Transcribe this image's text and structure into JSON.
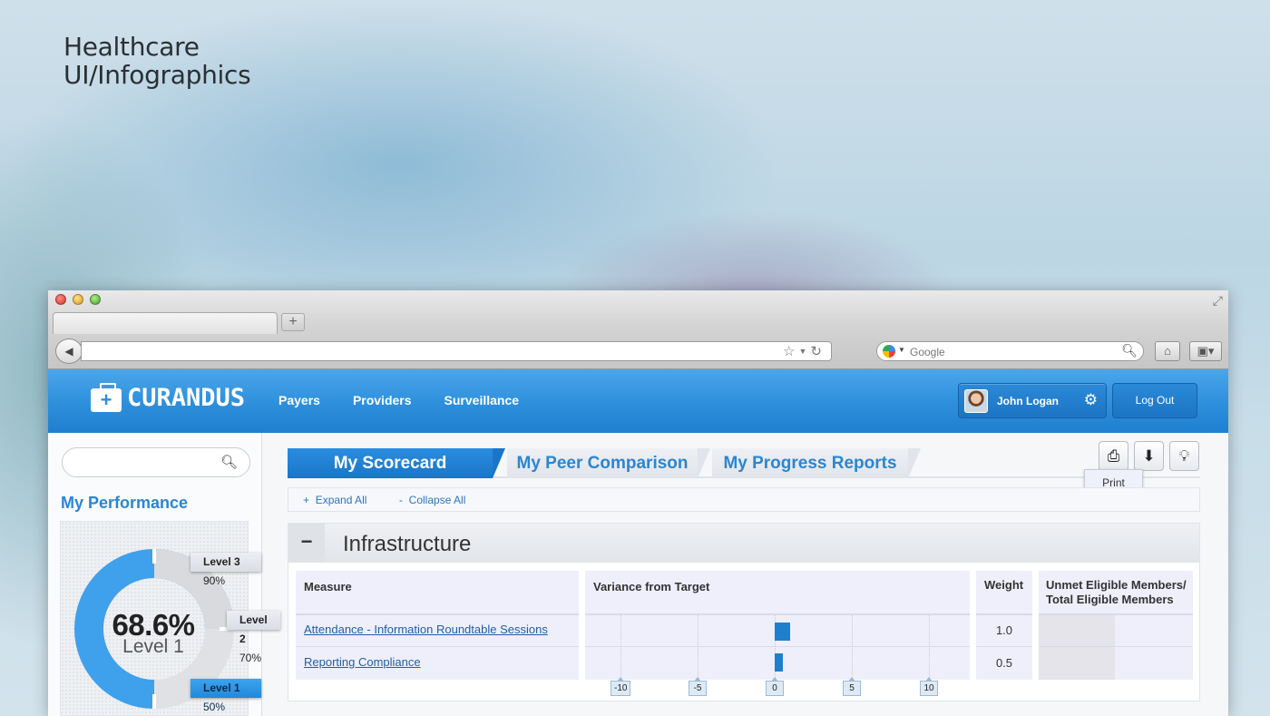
{
  "headline": {
    "line1": "Healthcare",
    "line2": "UI/Infographics"
  },
  "browser": {
    "search_placeholder": "Google",
    "new_tab_symbol": "+"
  },
  "app": {
    "logo_text": "CURANDUS",
    "nav": [
      "Payers",
      "Providers",
      "Surveillance"
    ],
    "user_name": "John Logan",
    "logout_label": "Log Out"
  },
  "sidebar": {
    "performance_title": "My Performance",
    "score_value": "68.6%",
    "score_level": "Level 1",
    "levels": [
      {
        "name": "Level 3",
        "pct": "90%"
      },
      {
        "name": "Level 2",
        "pct": "70%"
      },
      {
        "name": "Level 1",
        "pct": "50%"
      }
    ]
  },
  "tabs": [
    "My Scorecard",
    "My Peer Comparison",
    "My Progress Reports"
  ],
  "tooltip": "Print",
  "actions": {
    "expand_all": "Expand All",
    "collapse_all": "Collapse All"
  },
  "section": {
    "collapse_symbol": "−",
    "title": "Infrastructure",
    "headers": {
      "measure": "Measure",
      "variance": "Variance from Target",
      "weight": "Weight",
      "unmet_line1": "Unmet Eligible Members/",
      "unmet_line2": "Total Eligible Members"
    },
    "rows": [
      {
        "measure": "Attendance -  Information Roundtable Sessions",
        "variance": 1,
        "weight": "1.0"
      },
      {
        "measure": "Reporting Compliance",
        "variance": 0.5,
        "weight": "0.5"
      }
    ],
    "variance_ticks": [
      "-10",
      "-5",
      "0",
      "5",
      "10"
    ]
  },
  "colors": {
    "brand_blue": "#2d8fdc",
    "link_blue": "#1f5fa6",
    "bar_blue": "#1f7fcf"
  }
}
